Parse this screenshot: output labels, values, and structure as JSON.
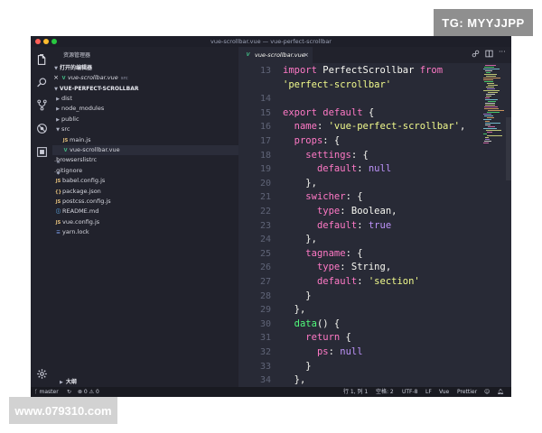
{
  "watermarks": {
    "top": "TG: MYYJJPP",
    "bottom": "www.079310.com"
  },
  "window": {
    "title": "vue-scrollbar.vue — vue-perfect-scrollbar"
  },
  "sidebar": {
    "title": "资源管理器",
    "open_editors_label": "打开的编辑器",
    "open_file": {
      "name": "vue-scrollbar.vue",
      "dir": "src"
    },
    "project_label": "VUE-PERFECT-SCROLLBAR",
    "tree": [
      {
        "label": "dist",
        "type": "folder",
        "open": false,
        "depth": 1
      },
      {
        "label": "node_modules",
        "type": "folder",
        "open": false,
        "depth": 1
      },
      {
        "label": "public",
        "type": "folder",
        "open": false,
        "depth": 1
      },
      {
        "label": "src",
        "type": "folder",
        "open": true,
        "depth": 1
      },
      {
        "label": "main.js",
        "type": "js",
        "icon": "JS",
        "depth": 2
      },
      {
        "label": "vue-scrollbar.vue",
        "type": "vue",
        "icon": "V",
        "depth": 2,
        "active": true
      },
      {
        "label": ".browserslistrc",
        "type": "dot",
        "icon": "≡",
        "depth": 1
      },
      {
        "label": ".gitignore",
        "type": "dot",
        "icon": "◆",
        "depth": 1
      },
      {
        "label": "babel.config.js",
        "type": "js",
        "icon": "JS",
        "depth": 1
      },
      {
        "label": "package.json",
        "type": "json",
        "icon": "{}",
        "depth": 1
      },
      {
        "label": "postcss.config.js",
        "type": "js",
        "icon": "JS",
        "depth": 1
      },
      {
        "label": "README.md",
        "type": "md",
        "icon": "ⓘ",
        "depth": 1
      },
      {
        "label": "vue.config.js",
        "type": "js",
        "icon": "JS",
        "depth": 1
      },
      {
        "label": "yarn.lock",
        "type": "lock",
        "icon": "☰",
        "depth": 1
      }
    ],
    "outline_label": "大纲"
  },
  "tab": {
    "label": "vue-scrollbar.vue",
    "icon": "V"
  },
  "editor": {
    "lines": [
      {
        "n": "13",
        "tokens": [
          [
            "kw",
            "import"
          ],
          [
            "pn",
            " "
          ],
          [
            "cls",
            "PerfectScrollbar"
          ],
          [
            "pn",
            " "
          ],
          [
            "kw",
            "from"
          ]
        ]
      },
      {
        "n": "",
        "tokens": [
          [
            "str",
            "'perfect-scrollbar'"
          ]
        ]
      },
      {
        "n": "14",
        "tokens": []
      },
      {
        "n": "15",
        "tokens": [
          [
            "kw",
            "export"
          ],
          [
            "pn",
            " "
          ],
          [
            "kw",
            "default"
          ],
          [
            "pn",
            " {"
          ]
        ]
      },
      {
        "n": "16",
        "tokens": [
          [
            "pn",
            "  "
          ],
          [
            "prop",
            "name"
          ],
          [
            "pn",
            ": "
          ],
          [
            "str",
            "'vue-perfect-scrollbar'"
          ],
          [
            "pn",
            ","
          ]
        ]
      },
      {
        "n": "17",
        "tokens": [
          [
            "pn",
            "  "
          ],
          [
            "prop",
            "props"
          ],
          [
            "pn",
            ": {"
          ]
        ]
      },
      {
        "n": "18",
        "tokens": [
          [
            "pn",
            "    "
          ],
          [
            "prop",
            "settings"
          ],
          [
            "pn",
            ": {"
          ]
        ]
      },
      {
        "n": "19",
        "tokens": [
          [
            "pn",
            "      "
          ],
          [
            "prop",
            "default"
          ],
          [
            "pn",
            ": "
          ],
          [
            "val",
            "null"
          ]
        ]
      },
      {
        "n": "20",
        "tokens": [
          [
            "pn",
            "    },"
          ]
        ]
      },
      {
        "n": "21",
        "tokens": [
          [
            "pn",
            "    "
          ],
          [
            "prop",
            "swicher"
          ],
          [
            "pn",
            ": {"
          ]
        ]
      },
      {
        "n": "22",
        "tokens": [
          [
            "pn",
            "      "
          ],
          [
            "prop",
            "type"
          ],
          [
            "pn",
            ": "
          ],
          [
            "cls",
            "Boolean"
          ],
          [
            "pn",
            ","
          ]
        ]
      },
      {
        "n": "23",
        "tokens": [
          [
            "pn",
            "      "
          ],
          [
            "prop",
            "default"
          ],
          [
            "pn",
            ": "
          ],
          [
            "val",
            "true"
          ]
        ]
      },
      {
        "n": "24",
        "tokens": [
          [
            "pn",
            "    },"
          ]
        ]
      },
      {
        "n": "25",
        "tokens": [
          [
            "pn",
            "    "
          ],
          [
            "prop",
            "tagname"
          ],
          [
            "pn",
            ": {"
          ]
        ]
      },
      {
        "n": "26",
        "tokens": [
          [
            "pn",
            "      "
          ],
          [
            "prop",
            "type"
          ],
          [
            "pn",
            ": "
          ],
          [
            "cls",
            "String"
          ],
          [
            "pn",
            ","
          ]
        ]
      },
      {
        "n": "27",
        "tokens": [
          [
            "pn",
            "      "
          ],
          [
            "prop",
            "default"
          ],
          [
            "pn",
            ": "
          ],
          [
            "str",
            "'section'"
          ]
        ]
      },
      {
        "n": "28",
        "tokens": [
          [
            "pn",
            "    }"
          ]
        ]
      },
      {
        "n": "29",
        "tokens": [
          [
            "pn",
            "  },"
          ]
        ]
      },
      {
        "n": "30",
        "tokens": [
          [
            "pn",
            "  "
          ],
          [
            "fn",
            "data"
          ],
          [
            "pn",
            "() {"
          ]
        ]
      },
      {
        "n": "31",
        "tokens": [
          [
            "pn",
            "    "
          ],
          [
            "kw",
            "return"
          ],
          [
            "pn",
            " {"
          ]
        ]
      },
      {
        "n": "32",
        "tokens": [
          [
            "pn",
            "      "
          ],
          [
            "prop",
            "ps"
          ],
          [
            "pn",
            ": "
          ],
          [
            "val",
            "null"
          ]
        ]
      },
      {
        "n": "33",
        "tokens": [
          [
            "pn",
            "    }"
          ]
        ]
      },
      {
        "n": "34",
        "tokens": [
          [
            "pn",
            "  },"
          ]
        ]
      }
    ]
  },
  "statusbar": {
    "branch": "master",
    "sync_icon": "↻",
    "problems": "⊗ 0 ⚠ 0",
    "position": "行 1, 列 1",
    "spaces": "空格: 2",
    "encoding": "UTF-8",
    "eol": "LF",
    "language": "Vue",
    "formatter": "Prettier"
  },
  "colors": {
    "editor_bg": "#282a36",
    "sidebar_bg": "#21222c",
    "keyword": "#ff79c6",
    "string": "#f1fa8c",
    "constant": "#bd93f9",
    "function": "#50fa7b"
  }
}
